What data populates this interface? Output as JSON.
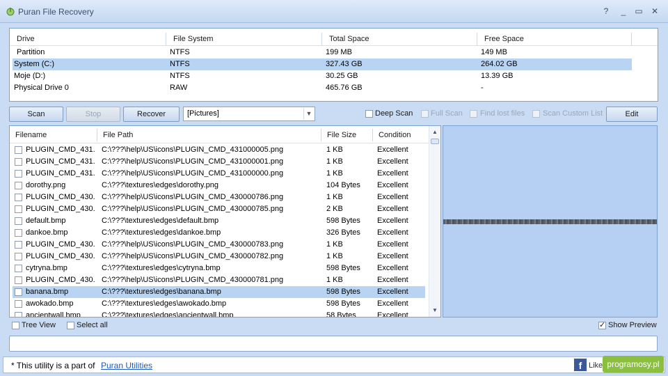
{
  "window": {
    "title": "Puran File Recovery",
    "help_glyph": "?",
    "minimize_glyph": "_",
    "maximize_glyph": "▭",
    "close_glyph": "✕"
  },
  "drives": {
    "columns": [
      "Drive",
      "File System",
      "Total Space",
      "Free Space"
    ],
    "partition_label": "Partition",
    "partition_fs": "NTFS",
    "partition_total": "199 MB",
    "partition_free": "149 MB",
    "rows": [
      {
        "drive": "System (C:)",
        "fs": "NTFS",
        "total": "327.43 GB",
        "free": "264.02 GB",
        "selected": true
      },
      {
        "drive": "Moje (D:)",
        "fs": "NTFS",
        "total": "30.25 GB",
        "free": "13.39 GB",
        "selected": false
      },
      {
        "drive": "Physical Drive 0",
        "fs": "RAW",
        "total": "465.76 GB",
        "free": "-",
        "selected": false
      }
    ]
  },
  "toolbar": {
    "scan_label": "Scan",
    "stop_label": "Stop",
    "recover_label": "Recover",
    "filter_value": "[Pictures]",
    "deep_scan_label": "Deep Scan",
    "full_scan_label": "Full Scan",
    "find_lost_label": "Find lost files",
    "scan_custom_label": "Scan Custom List",
    "edit_label": "Edit"
  },
  "files": {
    "columns": [
      "Filename",
      "File Path",
      "File Size",
      "Condition"
    ],
    "rows": [
      {
        "name": "PLUGIN_CMD_431...",
        "path": "C:\\???\\help\\US\\icons\\PLUGIN_CMD_431000005.png",
        "size": "1 KB",
        "condition": "Excellent",
        "selected": false
      },
      {
        "name": "PLUGIN_CMD_431...",
        "path": "C:\\???\\help\\US\\icons\\PLUGIN_CMD_431000001.png",
        "size": "1 KB",
        "condition": "Excellent",
        "selected": false
      },
      {
        "name": "PLUGIN_CMD_431...",
        "path": "C:\\???\\help\\US\\icons\\PLUGIN_CMD_431000000.png",
        "size": "1 KB",
        "condition": "Excellent",
        "selected": false
      },
      {
        "name": "dorothy.png",
        "path": "C:\\???\\textures\\edges\\dorothy.png",
        "size": "104 Bytes",
        "condition": "Excellent",
        "selected": false
      },
      {
        "name": "PLUGIN_CMD_430...",
        "path": "C:\\???\\help\\US\\icons\\PLUGIN_CMD_430000786.png",
        "size": "1 KB",
        "condition": "Excellent",
        "selected": false
      },
      {
        "name": "PLUGIN_CMD_430...",
        "path": "C:\\???\\help\\US\\icons\\PLUGIN_CMD_430000785.png",
        "size": "2 KB",
        "condition": "Excellent",
        "selected": false
      },
      {
        "name": "default.bmp",
        "path": "C:\\???\\textures\\edges\\default.bmp",
        "size": "598 Bytes",
        "condition": "Excellent",
        "selected": false
      },
      {
        "name": "dankoe.bmp",
        "path": "C:\\???\\textures\\edges\\dankoe.bmp",
        "size": "326 Bytes",
        "condition": "Excellent",
        "selected": false
      },
      {
        "name": "PLUGIN_CMD_430...",
        "path": "C:\\???\\help\\US\\icons\\PLUGIN_CMD_430000783.png",
        "size": "1 KB",
        "condition": "Excellent",
        "selected": false
      },
      {
        "name": "PLUGIN_CMD_430...",
        "path": "C:\\???\\help\\US\\icons\\PLUGIN_CMD_430000782.png",
        "size": "1 KB",
        "condition": "Excellent",
        "selected": false
      },
      {
        "name": "cytryna.bmp",
        "path": "C:\\???\\textures\\edges\\cytryna.bmp",
        "size": "598 Bytes",
        "condition": "Excellent",
        "selected": false
      },
      {
        "name": "PLUGIN_CMD_430...",
        "path": "C:\\???\\help\\US\\icons\\PLUGIN_CMD_430000781.png",
        "size": "1 KB",
        "condition": "Excellent",
        "selected": false
      },
      {
        "name": "banana.bmp",
        "path": "C:\\???\\textures\\edges\\banana.bmp",
        "size": "598 Bytes",
        "condition": "Excellent",
        "selected": true
      },
      {
        "name": "awokado.bmp",
        "path": "C:\\???\\textures\\edges\\awokado.bmp",
        "size": "598 Bytes",
        "condition": "Excellent",
        "selected": false
      },
      {
        "name": "ancientwall.bmp",
        "path": "C:\\???\\textures\\edges\\ancientwall.bmp",
        "size": "58 Bytes",
        "condition": "Excellent",
        "selected": false
      }
    ]
  },
  "options": {
    "tree_view_label": "Tree View",
    "select_all_label": "Select all",
    "show_preview_label": "Show Preview"
  },
  "footer": {
    "text": "* This utility is a part of",
    "link": "Puran Utilities",
    "like_label": "Like",
    "fb_glyph": "f",
    "watermark": "programosy.pl"
  },
  "colors": {
    "selection": "#b9d4f3",
    "background": "#c9dcf3",
    "link": "#1a5cc8"
  }
}
